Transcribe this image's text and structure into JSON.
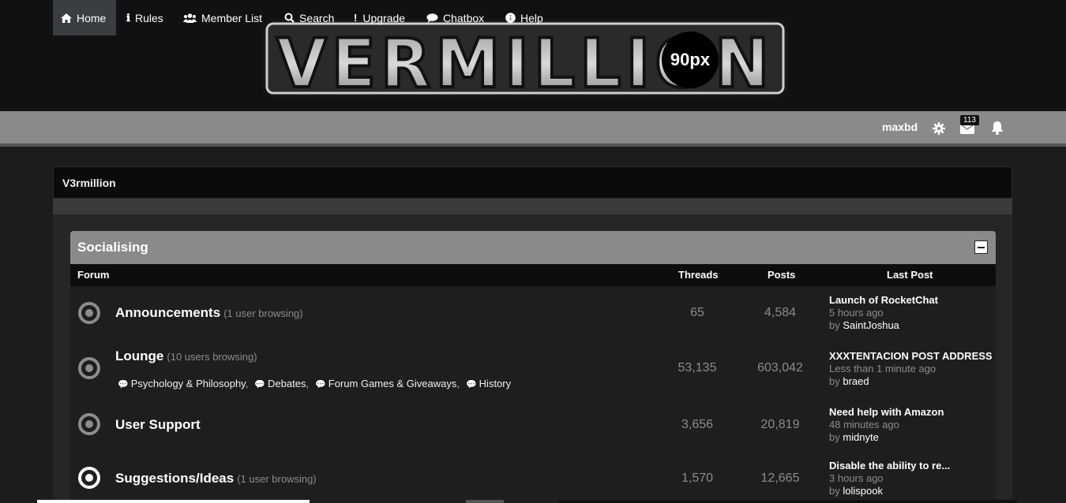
{
  "logo": {
    "text": "VERMILLION",
    "badge": "90px"
  },
  "nav": {
    "items": [
      {
        "label": "Home",
        "icon": "home-icon"
      },
      {
        "label": "Rules",
        "icon": "info-icon"
      },
      {
        "label": "Member List",
        "icon": "users-icon"
      },
      {
        "label": "Search",
        "icon": "search-icon"
      },
      {
        "label": "Upgrade",
        "icon": "exclamation-icon"
      },
      {
        "label": "Chatbox",
        "icon": "chat-icon"
      },
      {
        "label": "Help",
        "icon": "info-circle-icon"
      }
    ],
    "username": "maxbd",
    "mail_count": "113"
  },
  "breadcrumb": "V3rmillion",
  "category": {
    "title": "Socialising",
    "columns": {
      "forum": "Forum",
      "threads": "Threads",
      "posts": "Posts",
      "last_post": "Last Post"
    },
    "forums": [
      {
        "name": "Announcements",
        "browsing": "(1 user browsing)",
        "threads": "65",
        "posts": "4,584",
        "last_title": "Launch of RocketChat",
        "last_time": "5 hours ago",
        "by": "by",
        "last_user": "SaintJoshua"
      },
      {
        "name": "Lounge",
        "browsing": "(10 users browsing)",
        "threads": "53,135",
        "posts": "603,042",
        "subforums": [
          "Psychology & Philosophy",
          "Debates",
          "Forum Games & Giveaways",
          "History"
        ],
        "last_title": "XXXTENTACION POST ADDRESS",
        "last_time": "Less than 1 minute ago",
        "by": "by",
        "last_user": "braed"
      },
      {
        "name": "User Support",
        "browsing": "",
        "threads": "3,656",
        "posts": "20,819",
        "last_title": "Need help with Amazon",
        "last_time": "48 minutes ago",
        "by": "by",
        "last_user": "midnyte"
      },
      {
        "name": "Suggestions/Ideas",
        "browsing": "(1 user browsing)",
        "threads": "1,570",
        "posts": "12,665",
        "last_title": "Disable the ability to re...",
        "last_time": "3 hours ago",
        "by": "by",
        "last_user": "lolispook"
      }
    ]
  },
  "colors": {
    "navbar": "#8a8a8a",
    "active_tab": "#3a3e42",
    "header_bg": "#111111",
    "panel": "#262626"
  }
}
